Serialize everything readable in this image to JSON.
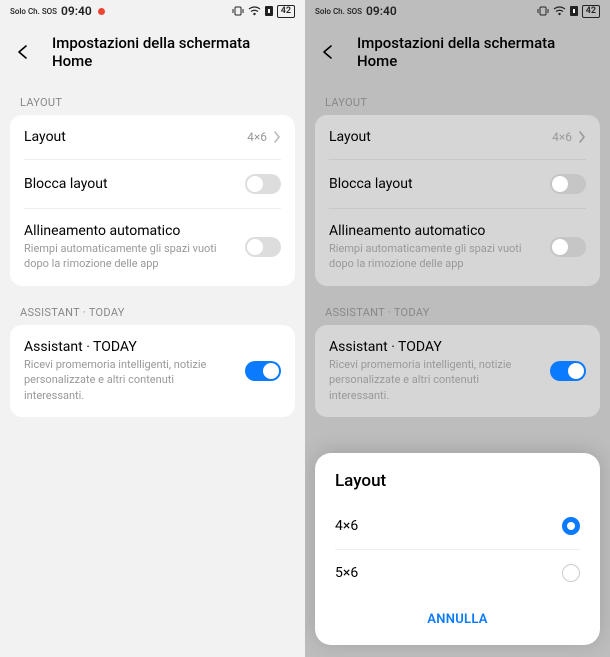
{
  "status_bar": {
    "carrier": "Solo Ch. SOS",
    "time": "09:40",
    "battery": "42"
  },
  "header": {
    "title": "Impostazioni della schermata Home"
  },
  "sections": {
    "layout_label": "LAYOUT",
    "assistant_label": "ASSISTANT · TODAY"
  },
  "rows": {
    "layout": {
      "title": "Layout",
      "value": "4×6"
    },
    "lock_layout": {
      "title": "Blocca layout"
    },
    "auto_align": {
      "title": "Allineamento automatico",
      "subtitle": "Riempi automaticamente gli spazi vuoti dopo la rimozione delle app"
    },
    "assistant": {
      "title": "Assistant · TODAY",
      "subtitle": "Ricevi promemoria intelligenti, notizie personalizzate e altri contenuti interessanti."
    }
  },
  "sheet": {
    "title": "Layout",
    "options": {
      "o1": "4×6",
      "o2": "5×6"
    },
    "cancel": "ANNULLA"
  }
}
